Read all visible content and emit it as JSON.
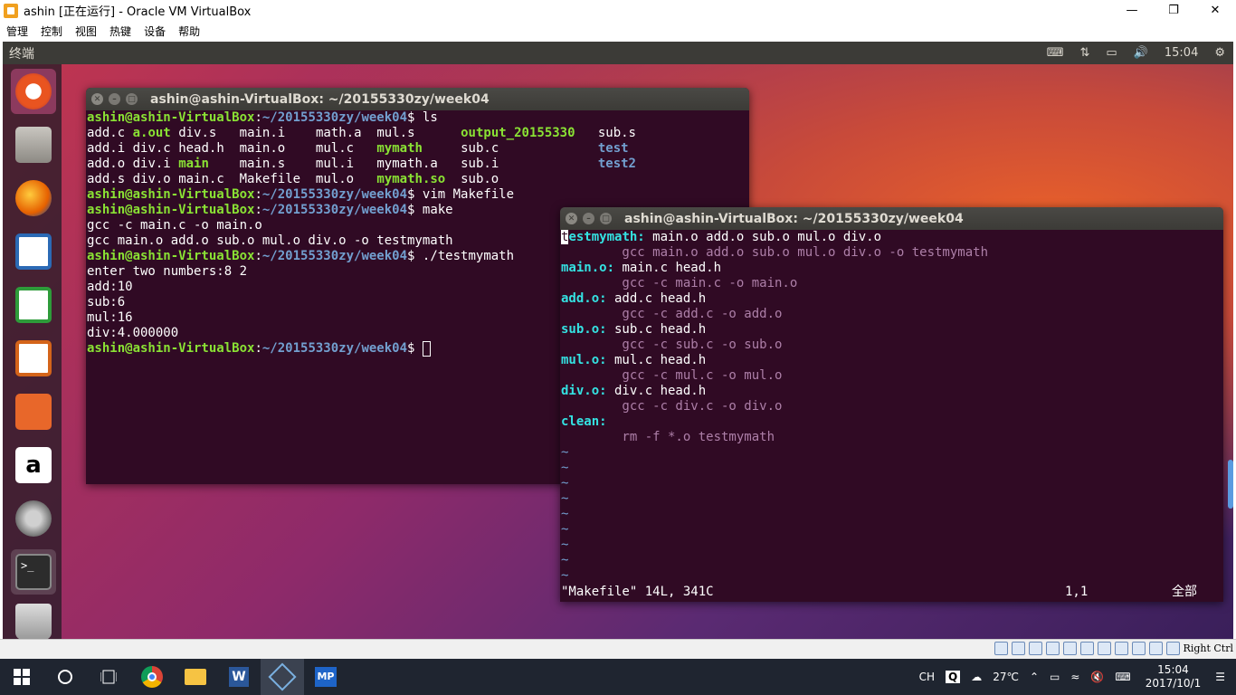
{
  "host": {
    "title": "ashin [正在运行] - Oracle VM VirtualBox",
    "menu": [
      "管理",
      "控制",
      "视图",
      "热键",
      "设备",
      "帮助"
    ],
    "host_key": "Right Ctrl"
  },
  "guest": {
    "topbar": {
      "title": "终端",
      "time": "15:04"
    },
    "launcher": [
      "ubuntu-dash",
      "files",
      "firefox",
      "libreoffice-writer",
      "libreoffice-calc",
      "libreoffice-impress",
      "ubuntu-software",
      "amazon",
      "system-settings",
      "terminal",
      "trash"
    ]
  },
  "term1": {
    "title": "ashin@ashin-VirtualBox: ~/20155330zy/week04",
    "prompt_user": "ashin@ashin-VirtualBox",
    "prompt_path": "~/20155330zy/week04",
    "cmds": [
      "ls",
      "vim Makefile",
      "make",
      "./testmymath"
    ],
    "ls_rows": [
      [
        "add.c",
        "a.out",
        "div.s",
        "main.i",
        "math.a",
        "mul.s",
        "output_20155330",
        "sub.s"
      ],
      [
        "add.i",
        "div.c",
        "head.h",
        "main.o",
        "mul.c",
        "mymath",
        "sub.c",
        "test"
      ],
      [
        "add.o",
        "div.i",
        "main",
        "main.s",
        "mul.i",
        "mymath.a",
        "sub.i",
        "test2"
      ],
      [
        "add.s",
        "div.o",
        "main.c",
        "Makefile",
        "mul.o",
        "mymath.so",
        "sub.o",
        ""
      ]
    ],
    "make_out": [
      "gcc -c main.c -o main.o",
      "gcc main.o add.o sub.o mul.o div.o -o testmymath"
    ],
    "run_out": [
      "enter two numbers:8 2",
      "add:10",
      "sub:6",
      "mul:16",
      "div:4.000000"
    ]
  },
  "term2": {
    "title": "ashin@ashin-VirtualBox: ~/20155330zy/week04",
    "rules": [
      {
        "target": "testmymath:",
        "deps": " main.o add.o sub.o mul.o div.o",
        "cmd": "        gcc main.o add.o sub.o mul.o div.o -o testmymath"
      },
      {
        "target": "main.o:",
        "deps": " main.c head.h",
        "cmd": "        gcc -c main.c -o main.o"
      },
      {
        "target": "add.o:",
        "deps": " add.c head.h",
        "cmd": "        gcc -c add.c -o add.o"
      },
      {
        "target": "sub.o:",
        "deps": " sub.c head.h",
        "cmd": "        gcc -c sub.c -o sub.o"
      },
      {
        "target": "mul.o:",
        "deps": " mul.c head.h",
        "cmd": "        gcc -c mul.c -o mul.o"
      },
      {
        "target": "div.o:",
        "deps": " div.c head.h",
        "cmd": "        gcc -c div.c -o div.o"
      },
      {
        "target": "clean:",
        "deps": "",
        "cmd": "        rm -f *.o testmymath"
      }
    ],
    "tilde": "~",
    "status_file": "\"Makefile\" 14L, 341C",
    "status_pos": "1,1",
    "status_all": "全部"
  },
  "taskbar": {
    "lang": "CH",
    "ime": "Q",
    "temp": "27℃",
    "time": "15:04",
    "date": "2017/10/1",
    "apps": [
      "chrome",
      "file-explorer",
      "word",
      "virtualbox",
      "mp"
    ]
  }
}
